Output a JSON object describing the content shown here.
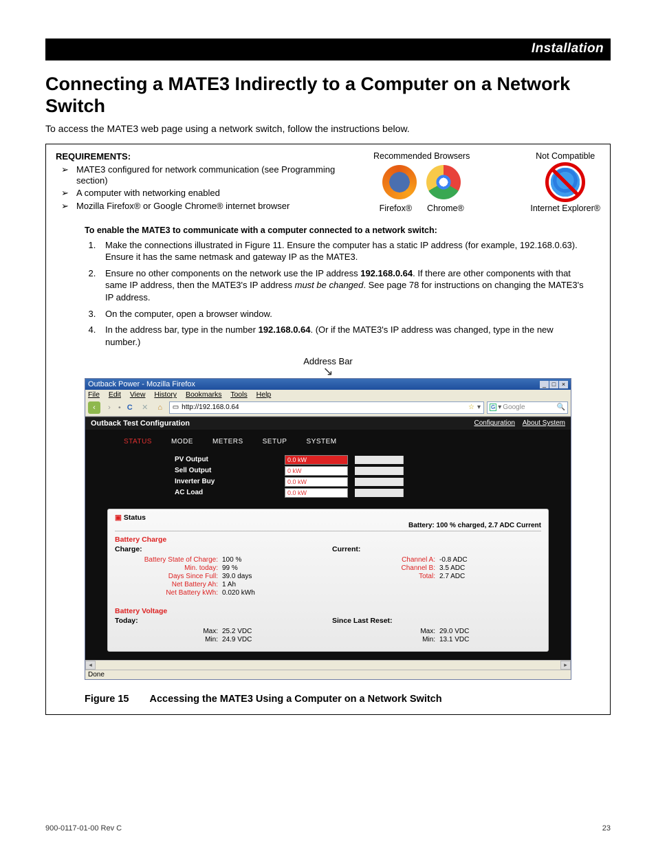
{
  "header_tab": "Installation",
  "h1": "Connecting a MATE3 Indirectly to a Computer on a Network Switch",
  "intro": "To access the MATE3 web page using a network switch, follow the instructions below.",
  "requirements": {
    "title": "REQUIREMENTS:",
    "items": [
      "MATE3 configured for network communication (see Programming section)",
      "A computer with networking enabled",
      "Mozilla Firefox® or Google Chrome® internet browser"
    ],
    "recommended_label": "Recommended Browsers",
    "not_compatible_label": "Not Compatible",
    "firefox_label": "Firefox®",
    "chrome_label": "Chrome®",
    "ie_label": "Internet Explorer®"
  },
  "enable_title": "To enable the MATE3 to communicate with a computer connected to a network switch:",
  "steps": {
    "s1": "Make the connections illustrated in Figure 11.  Ensure the computer has a static IP address (for example, 192.168.0.63).  Ensure it has the same netmask and gateway IP as the MATE3.",
    "s2a": "Ensure no other components on the network use the IP address ",
    "s2b": "192.168.0.64",
    "s2c": ".  If there are other components with that same IP address, then the MATE3's IP address ",
    "s2d": "must be changed",
    "s2e": ". See page 78 for instructions on changing the MATE3's IP address.",
    "s3": "On the computer, open a browser window.",
    "s4a": "In the address bar, type in the number ",
    "s4b": "192.168.0.64",
    "s4c": ".  (Or if the MATE3's IP address was changed, type in the new number.)"
  },
  "address_bar_label": "Address Bar",
  "browser_window": {
    "title": "Outback Power - Mozilla Firefox",
    "menus": [
      "File",
      "Edit",
      "View",
      "History",
      "Bookmarks",
      "Tools",
      "Help"
    ],
    "url": "http://192.168.0.64",
    "search_placeholder": "Google",
    "page_title": "Outback Test Configuration",
    "top_links": [
      "Configuration",
      "About System"
    ],
    "tabs": [
      "STATUS",
      "MODE",
      "METERS",
      "SETUP",
      "SYSTEM"
    ],
    "meters": [
      {
        "label": "PV Output",
        "val": "0.0 kW"
      },
      {
        "label": "Sell Output",
        "val": "0 kW"
      },
      {
        "label": "Inverter Buy",
        "val": "0.0 kW"
      },
      {
        "label": "AC Load",
        "val": "0.0 kW"
      }
    ],
    "status_label": "Status",
    "battery_banner": "Battery: 100 % charged, 2.7 ADC Current",
    "battery_charge": {
      "title": "Battery Charge",
      "charge_label": "Charge:",
      "current_label": "Current:",
      "left": [
        {
          "k": "Battery State of Charge:",
          "v": "100 %"
        },
        {
          "k": "Min. today:",
          "v": "99 %"
        },
        {
          "k": "Days Since Full:",
          "v": "39.0 days"
        },
        {
          "k": "Net Battery Ah:",
          "v": "1 Ah"
        },
        {
          "k": "Net Battery kWh:",
          "v": "0.020 kWh"
        }
      ],
      "right": [
        {
          "k": "Channel A:",
          "v": "-0.8 ADC"
        },
        {
          "k": "Channel B:",
          "v": "3.5 ADC"
        },
        {
          "k": "Total:",
          "v": "2.7 ADC"
        }
      ]
    },
    "battery_voltage": {
      "title": "Battery Voltage",
      "today_label": "Today:",
      "reset_label": "Since Last Reset:",
      "left": [
        {
          "k": "Max:",
          "v": "25.2 VDC"
        },
        {
          "k": "Min:",
          "v": "24.9 VDC"
        }
      ],
      "right": [
        {
          "k": "Max:",
          "v": "29.0 VDC"
        },
        {
          "k": "Min:",
          "v": "13.1 VDC"
        }
      ]
    },
    "status_text": "Done"
  },
  "figure": {
    "num": "Figure 15",
    "caption": "Accessing the MATE3 Using a Computer on a Network Switch"
  },
  "footer_left": "900-0117-01-00 Rev C",
  "footer_right": "23"
}
